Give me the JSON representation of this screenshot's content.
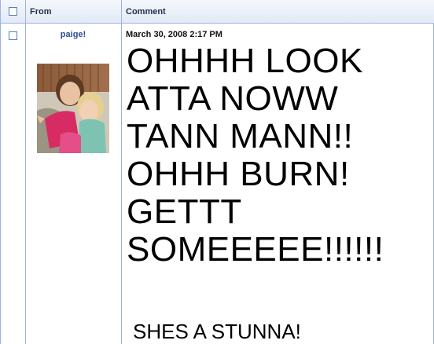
{
  "header": {
    "select_all_checked": false,
    "from_label": "From",
    "comment_label": "Comment"
  },
  "comment": {
    "selected": false,
    "author": "paige!",
    "avatar_icon": "user-photo-avatar",
    "timestamp": "March 30, 2008 2:17 PM",
    "lines": [
      "OHHHH LOOK",
      "ATTA NOWW",
      "TANN MANN!!",
      "OHHH BURN!",
      "GETTT",
      "SOMEEEEE!!!!!!"
    ],
    "signoff": "SHES A STUNNA!"
  },
  "colors": {
    "border": "#9db4d8",
    "header_bg": "#e3eaf6",
    "author_link": "#2d4f8c"
  }
}
